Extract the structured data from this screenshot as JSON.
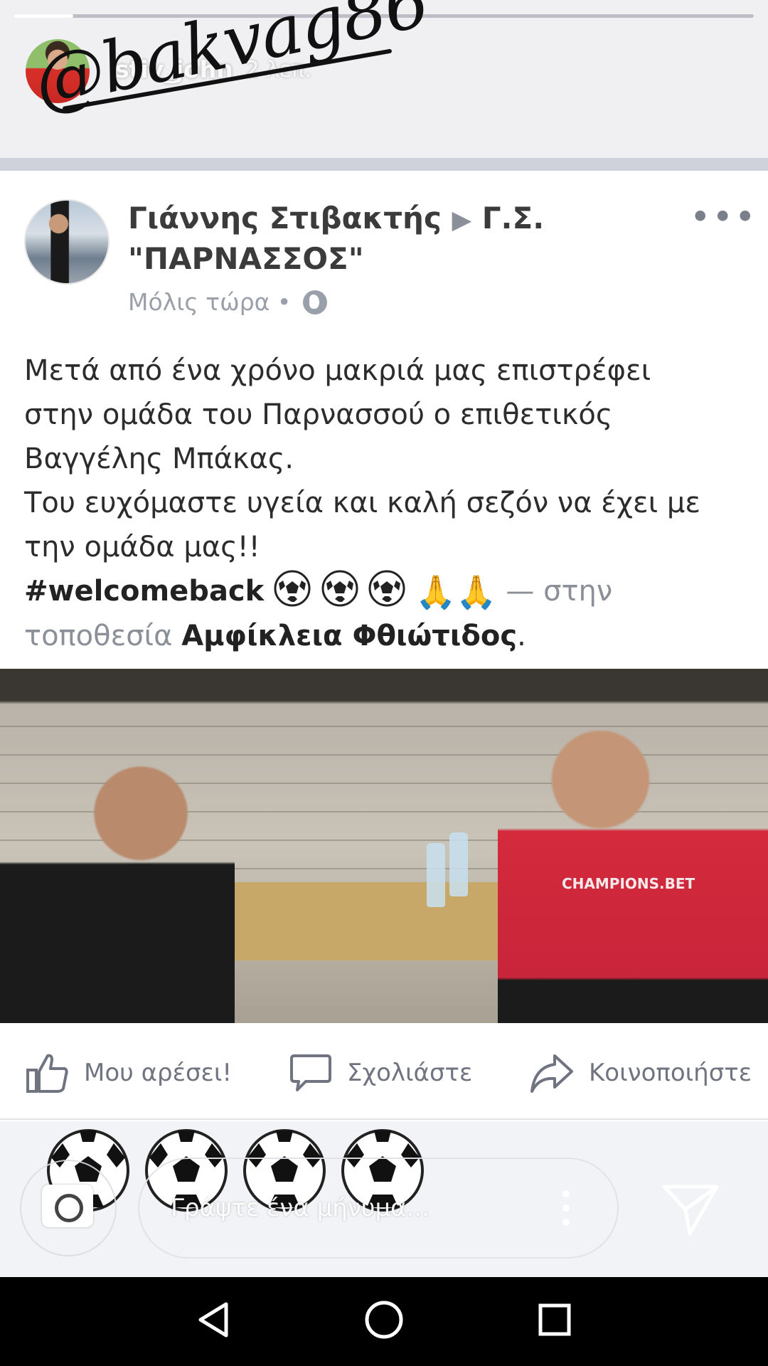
{
  "story": {
    "username": "stiv_john",
    "time_ago": "2 λεπ.",
    "mention_sticker": "@bakvag86",
    "progress_fraction": 0.08
  },
  "post": {
    "author": "Γιάννης Στιβακτής",
    "arrow": "▶",
    "group": "Γ.Σ. \"ΠΑΡΝΑΣΣΟΣ\"",
    "timestamp": "Μόλις τώρα",
    "separator": "•",
    "more": "•••",
    "body_lines": [
      "Μετά από ένα χρόνο μακριά μας επιστρέφει",
      "στην ομάδα του Παρνασσού ο επιθετικός",
      "Βαγγέλης Μπάκας.",
      "Του ευχόμαστε υγεία και καλή σεζόν να έχει με",
      "την ομάδα μας!!"
    ],
    "hashtag": "#welcomeback",
    "pray_emoji": "🙏🙏",
    "location_prefix": "— στην",
    "location_word": "τοποθεσία",
    "location_name": "Αμφίκλεια Φθιώτιδος",
    "location_end": ".",
    "photo_shirt_text": "CHAMPIONS.BET"
  },
  "actions": {
    "like": "Μου αρέσει!",
    "comment": "Σχολιάστε",
    "share": "Κοινοποιήστε"
  },
  "reply": {
    "placeholder": "Γράψτε ένα μήνυμα..."
  },
  "icons": {
    "like": "thumbs-up-icon",
    "comment": "comment-bubble-icon",
    "share": "share-arrow-icon",
    "camera": "camera-icon",
    "send": "send-icon",
    "globe": "globe-icon"
  }
}
